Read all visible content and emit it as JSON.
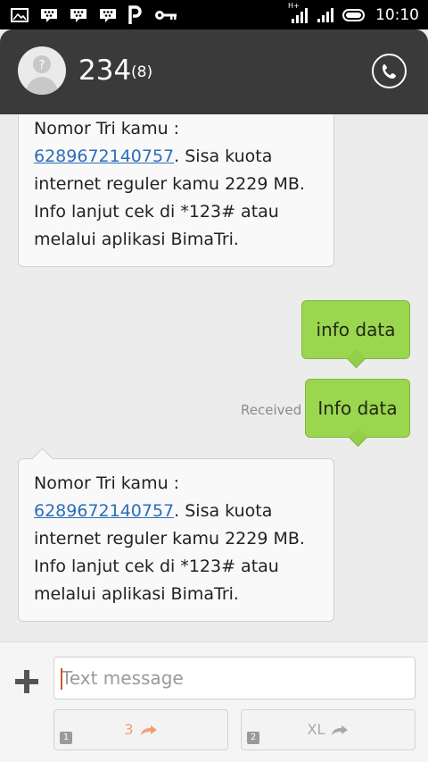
{
  "status_bar": {
    "left_icons": [
      "image-icon",
      "blackberry-icon",
      "blackberry-icon",
      "blackberry-icon",
      "p-letter-icon",
      "key-icon"
    ],
    "network": "H+",
    "time": "10:10"
  },
  "header": {
    "contact_name": "234",
    "message_count": "(8)"
  },
  "messages": [
    {
      "direction": "incoming",
      "text_before_link": "Nomor Tri kamu :",
      "link": "6289672140757",
      "text_after_link": ". Sisa kuota internet reguler kamu 2229 MB. Info lanjut cek di *123# atau melalui aplikasi BimaTri."
    },
    {
      "direction": "outgoing",
      "text": "info data"
    },
    {
      "direction": "outgoing",
      "text": "Info data",
      "status": "Received"
    },
    {
      "direction": "incoming",
      "text_before_link": "Nomor Tri kamu :",
      "link": "6289672140757",
      "text_after_link": ". Sisa kuota internet reguler kamu 2229 MB. Info lanjut cek di *123# atau melalui aplikasi BimaTri."
    }
  ],
  "composer": {
    "placeholder": "Text message",
    "send_buttons": [
      {
        "sim": "1",
        "label": "3",
        "color": "#f0a070"
      },
      {
        "sim": "2",
        "label": "XL",
        "color": "#a8a8a8"
      }
    ]
  },
  "colors": {
    "header_bg": "#3a3a3a",
    "outgoing_bubble": "#9bd650",
    "link": "#2d6db8"
  }
}
